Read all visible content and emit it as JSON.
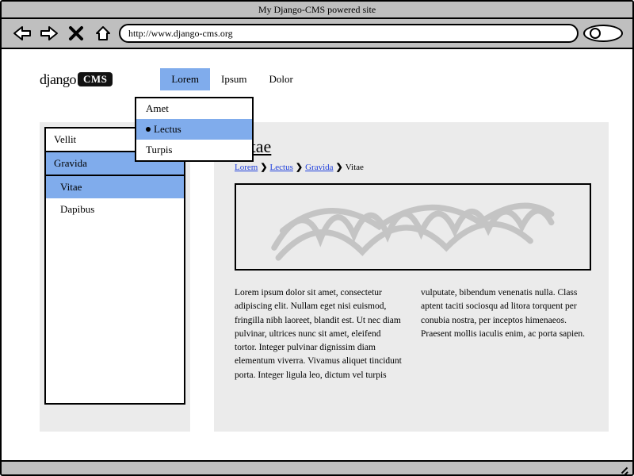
{
  "window": {
    "title": "My Django-CMS powered site",
    "url": "http://www.django-cms.org"
  },
  "logo": {
    "brand": "django",
    "box": "CMS"
  },
  "topnav": {
    "items": [
      "Lorem",
      "Ipsum",
      "Dolor"
    ],
    "active_index": 0
  },
  "dropdown": {
    "items": [
      "Amet",
      "Lectus",
      "Turpis"
    ],
    "selected_index": 1
  },
  "sidebar": {
    "items": [
      "Vellit",
      "Gravida",
      "Vitae",
      "Dapibus"
    ],
    "header_index": 1,
    "selected_index": 2
  },
  "page": {
    "title": "Vitae",
    "breadcrumb": [
      "Lorem",
      "Lectus",
      "Gravida",
      "Vitae"
    ]
  },
  "body_text": {
    "col1": "Lorem ipsum dolor sit amet, consectetur adipiscing elit. Nullam eget nisi euismod, fringilla nibh laoreet, blandit est. Ut nec diam pulvinar, ultrices nunc sit amet, eleifend tortor. Integer pulvinar dignissim diam elementum viverra. Vivamus aliquet tincidunt porta. Integer ligula leo, dictum vel turpis",
    "col2": "vulputate, bibendum venenatis nulla. Class aptent taciti sociosqu ad litora torquent per conubia nostra, per inceptos himenaeos. Praesent mollis iaculis enim, ac porta sapien."
  }
}
